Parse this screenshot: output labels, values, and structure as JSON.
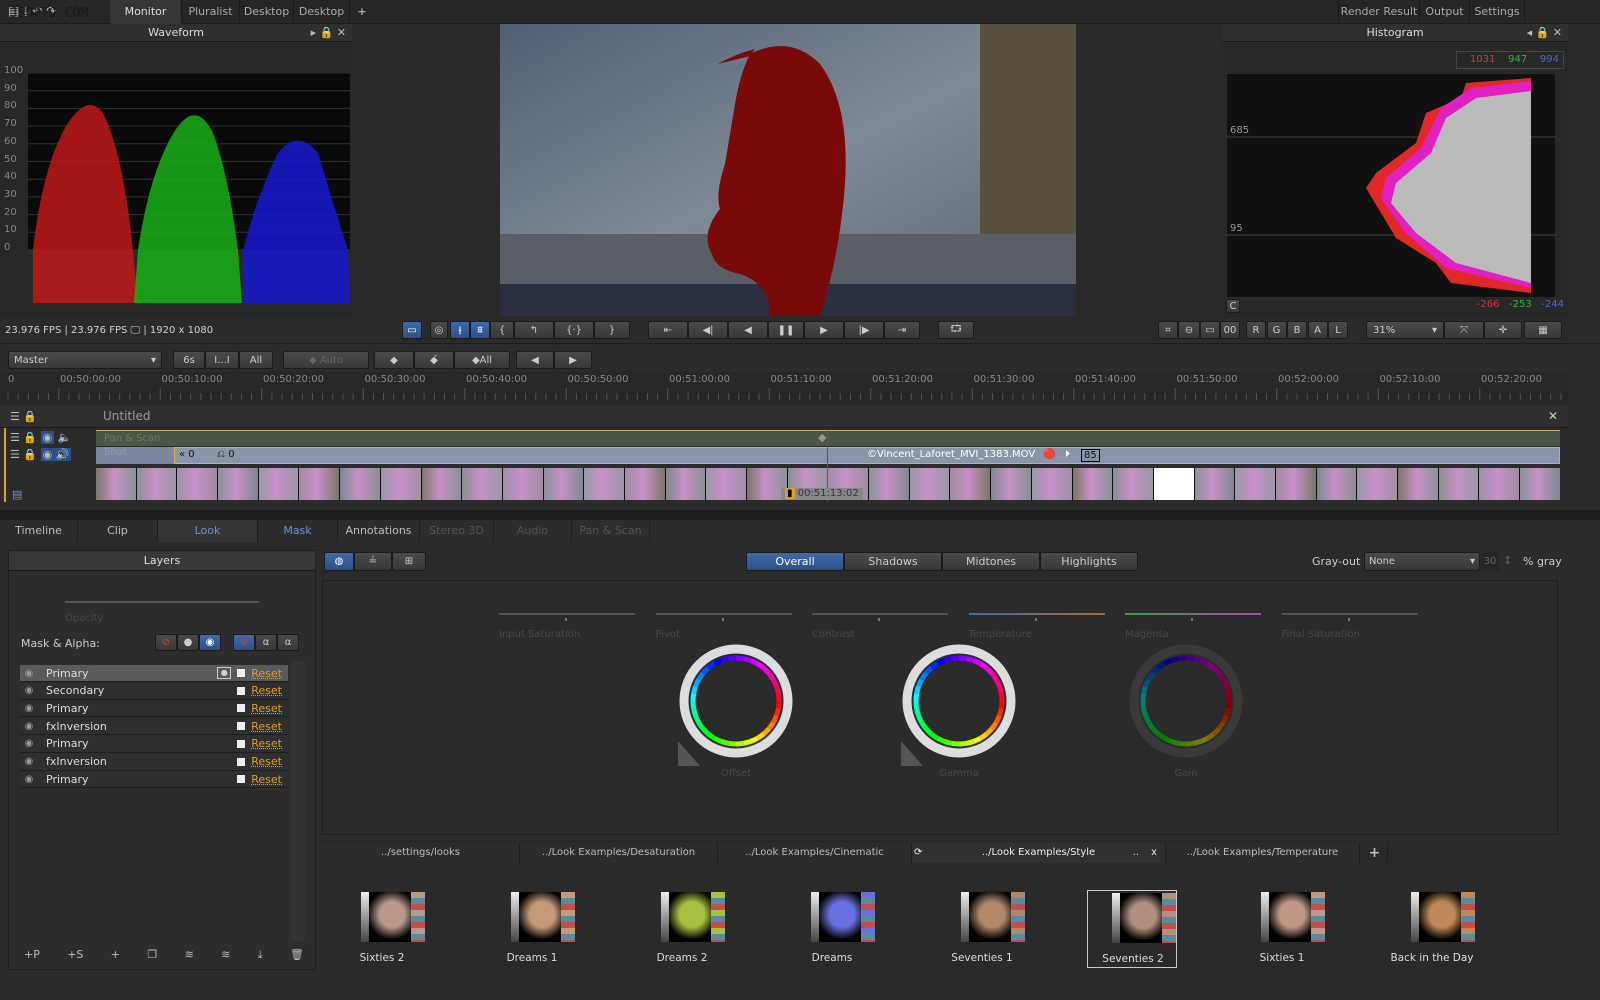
{
  "topbar": {
    "tabs": [
      "Monitor",
      "Pluralist",
      "Desktop",
      "Desktop"
    ],
    "add": "+",
    "right_tabs": [
      "Render Result",
      "Output",
      "Settings"
    ]
  },
  "waveform": {
    "title": "Waveform",
    "scale": [
      "100",
      "90",
      "80",
      "70",
      "60",
      "50",
      "40",
      "30",
      "20",
      "10",
      "0"
    ],
    "status": "23.976 FPS  |  23.976 FPS",
    "resolution": "|  1920 x 1080"
  },
  "histogram": {
    "title": "Histogram",
    "top_values": {
      "r": "1031",
      "g": "947",
      "b": "994"
    },
    "bottom_values": {
      "r": "-266",
      "g": "-253",
      "b": "-244"
    },
    "labels": [
      "685",
      "95"
    ],
    "c_button": "C"
  },
  "viewer_toolbar": {
    "channels": [
      "R",
      "G",
      "B",
      "A",
      "L"
    ],
    "zoom": "31%"
  },
  "keyframes": {
    "layer_select": "Master",
    "range_buttons": [
      "6s",
      "I...I",
      "All"
    ],
    "auto": "Auto",
    "all": "All"
  },
  "ruler": {
    "ticks": [
      "0",
      "00:50:00:00",
      "00:50:10:00",
      "00:50:20:00",
      "00:50:30:00",
      "00:50:40:00",
      "00:50:50:00",
      "00:51:00:00",
      "00:51:10:00",
      "00:51:20:00",
      "00:51:30:00",
      "00:51:40:00",
      "00:51:50:00",
      "00:52:00:00",
      "00:52:10:00",
      "00:52:20:00"
    ]
  },
  "timeline": {
    "title": "Untitled",
    "pan_scan_track": "Pan & Scan",
    "clip_track": "Shot",
    "clip_in": "0",
    "clip_offset": "0",
    "clip_name": "©Vincent_Laforet_MVI_1383.MOV",
    "clip_badge": "85",
    "playhead_time": "00:51:13:02"
  },
  "main_tabs": [
    {
      "label": "Timeline"
    },
    {
      "label": "Clip"
    },
    {
      "label": "Look",
      "active": true
    },
    {
      "label": "Mask"
    },
    {
      "label": "Annotations"
    },
    {
      "label": "Stereo 3D",
      "disabled": true
    },
    {
      "label": "Audio",
      "disabled": true
    },
    {
      "label": "Pan & Scan",
      "disabled": true
    }
  ],
  "layers": {
    "title": "Layers",
    "opacity_label": "Opacity",
    "mask_alpha_label": "Mask & Alpha:",
    "reset_label": "Reset",
    "items": [
      "Primary",
      "Secondary",
      "Primary",
      "fxInversion",
      "Primary",
      "fxInversion",
      "Primary"
    ],
    "footer": [
      "+P",
      "+S",
      "+"
    ]
  },
  "look": {
    "ranges": [
      "Overall",
      "Shadows",
      "Midtones",
      "Highlights"
    ],
    "active_range": "Overall",
    "grayout_label": "Gray-out",
    "grayout_value": "None",
    "gray_percent": "30",
    "gray_unit": "% gray",
    "sliders": [
      "Input Saturation",
      "Pivot",
      "Contrast",
      "Temperature",
      "Magenta",
      "Final Saturation"
    ],
    "wheels": [
      "Offset",
      "Gamma",
      "Gain"
    ]
  },
  "look_browser": {
    "tabs": [
      "../settings/looks",
      "../Look Examples/Desaturation",
      "../Look Examples/Cinematic",
      "../Look Examples/Style",
      "../Look Examples/Temperature"
    ],
    "active_tab": "../Look Examples/Style",
    "tab_more": "..",
    "tab_close": "x",
    "add": "+",
    "looks": [
      {
        "name": "Sixties 2",
        "tint": "#b89a8c"
      },
      {
        "name": "Dreams 1",
        "tint": "#c49a78"
      },
      {
        "name": "Dreams 2",
        "tint": "#a8c040"
      },
      {
        "name": "Dreams",
        "tint": "#6a70e0"
      },
      {
        "name": "Seventies 1",
        "tint": "#b08868"
      },
      {
        "name": "Seventies 2",
        "tint": "#b09080",
        "selected": true
      },
      {
        "name": "Sixties 1",
        "tint": "#c09888"
      },
      {
        "name": "Back in the Day",
        "tint": "#c08858"
      }
    ]
  },
  "watermark": "JSOFTJ.COM"
}
